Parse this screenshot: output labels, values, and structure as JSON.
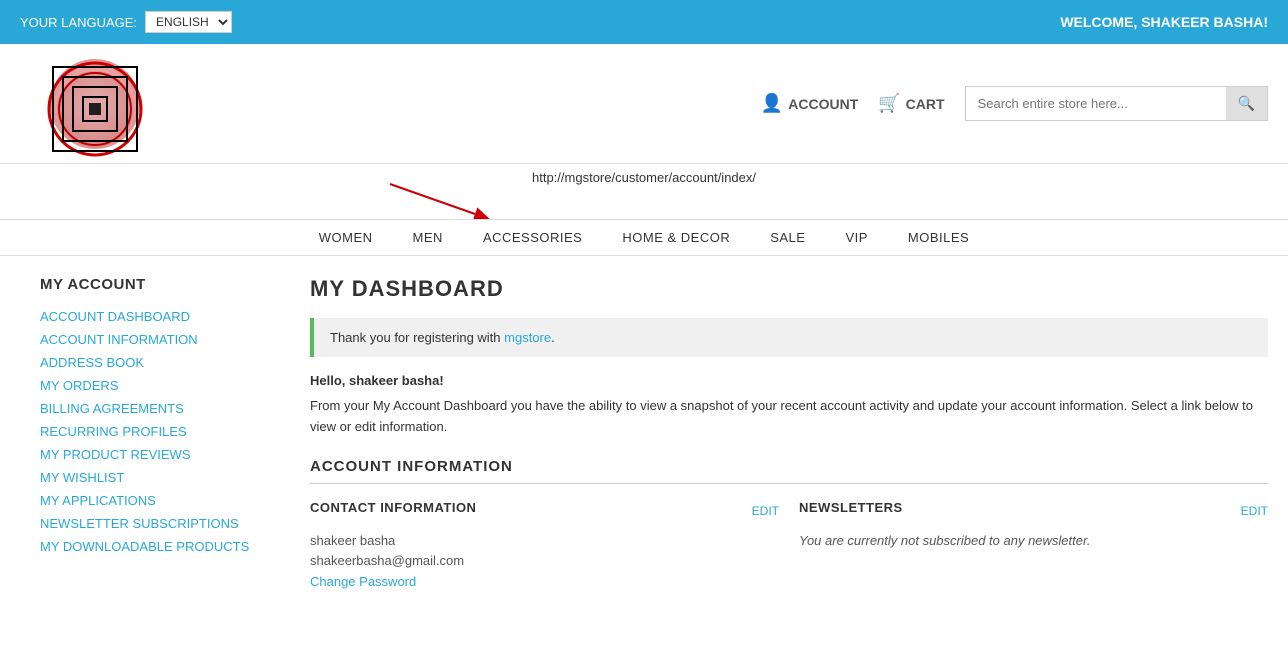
{
  "topbar": {
    "language_label": "YOUR LANGUAGE:",
    "language_value": "ENGLISH",
    "welcome_text": "WELCOME, SHAKEER BASHA!"
  },
  "header": {
    "account_label": "ACCOUNT",
    "cart_label": "CART",
    "search_placeholder": "Search entire store here..."
  },
  "nav": {
    "items": [
      {
        "label": "WOMEN"
      },
      {
        "label": "MEN"
      },
      {
        "label": "ACCESSORIES"
      },
      {
        "label": "HOME & DECOR"
      },
      {
        "label": "SALE"
      },
      {
        "label": "VIP"
      },
      {
        "label": "MOBILES"
      }
    ]
  },
  "url_annotation": {
    "url": "http://mgstore/customer/account/index/"
  },
  "sidebar": {
    "title": "MY ACCOUNT",
    "links": [
      {
        "label": "ACCOUNT DASHBOARD"
      },
      {
        "label": "ACCOUNT INFORMATION"
      },
      {
        "label": "ADDRESS BOOK"
      },
      {
        "label": "MY ORDERS"
      },
      {
        "label": "BILLING AGREEMENTS"
      },
      {
        "label": "RECURRING PROFILES"
      },
      {
        "label": "MY PRODUCT REVIEWS"
      },
      {
        "label": "MY WISHLIST"
      },
      {
        "label": "MY APPLICATIONS"
      },
      {
        "label": "NEWSLETTER SUBSCRIPTIONS"
      },
      {
        "label": "MY DOWNLOADABLE PRODUCTS"
      }
    ]
  },
  "main": {
    "dashboard_title": "MY DASHBOARD",
    "notice": {
      "text_prefix": "Thank you for registering with ",
      "store_name": "mgstore",
      "text_suffix": "."
    },
    "hello_text": "Hello, shakeer basha!",
    "description": "From your My Account Dashboard you have the ability to view a snapshot of your recent account activity and update your account information. Select a link below to view or edit information.",
    "account_information_title": "ACCOUNT INFORMATION",
    "contact": {
      "title": "CONTACT INFORMATION",
      "edit_label": "EDIT",
      "name": "shakeer basha",
      "email": "shakeerbasha@gmail.com",
      "change_password_link": "Change Password"
    },
    "newsletters": {
      "title": "NEWSLETTERS",
      "edit_label": "EDIT",
      "status_text": "You are currently not subscribed to any newsletter."
    }
  }
}
